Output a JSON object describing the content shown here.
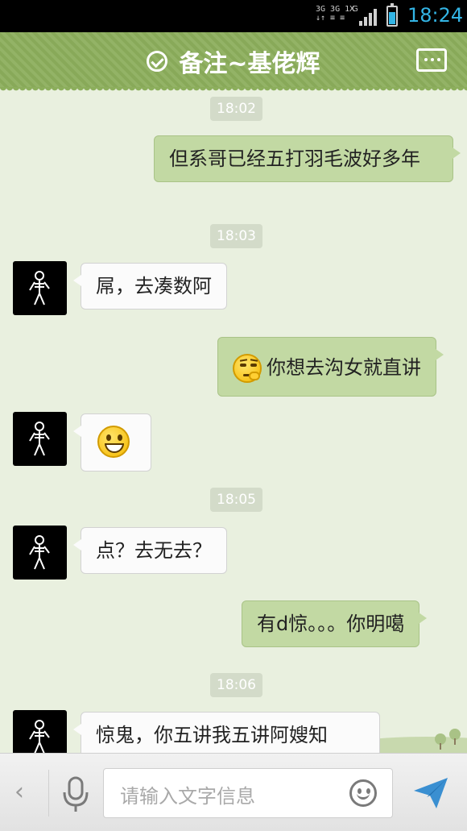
{
  "status_bar": {
    "network_top": "3G 3G 1X",
    "network_bottom": "↓↑ ≡ ≡",
    "network_letter": "G",
    "time": "18:24",
    "battery_level": 0.7
  },
  "header": {
    "title": "备注~基佬辉",
    "check_icon": "check-circle-icon",
    "menu_icon": "more-dots-icon"
  },
  "messages": [
    {
      "type": "timestamp",
      "text": "18:02"
    },
    {
      "type": "outgoing",
      "text": "但系哥已经五打羽毛波好多年"
    },
    {
      "type": "timestamp",
      "text": "18:03"
    },
    {
      "type": "incoming",
      "text": "屌，去凑数阿"
    },
    {
      "type": "outgoing",
      "emoji": "thinking-emoji",
      "text": "你想去沟女就直讲"
    },
    {
      "type": "incoming",
      "emoji": "grin-emoji"
    },
    {
      "type": "timestamp",
      "text": "18:05"
    },
    {
      "type": "incoming",
      "text": "点？去无去？"
    },
    {
      "type": "outgoing",
      "text": "有d惊。。。你明噶"
    },
    {
      "type": "timestamp",
      "text": "18:06"
    },
    {
      "type": "incoming",
      "text": "惊鬼，你五讲我五讲阿嫂知"
    }
  ],
  "input_bar": {
    "back_label": "‹",
    "placeholder": "请输入文字信息",
    "mic_icon": "microphone-icon",
    "emoji_icon": "smiley-icon",
    "send_icon": "send-icon"
  },
  "colors": {
    "header_bg": "#8cae5c",
    "chat_bg": "#e9f0df",
    "outgoing_bubble": "#c2d9a3",
    "incoming_bubble": "#fbfbfb",
    "status_time": "#33b5e5"
  }
}
